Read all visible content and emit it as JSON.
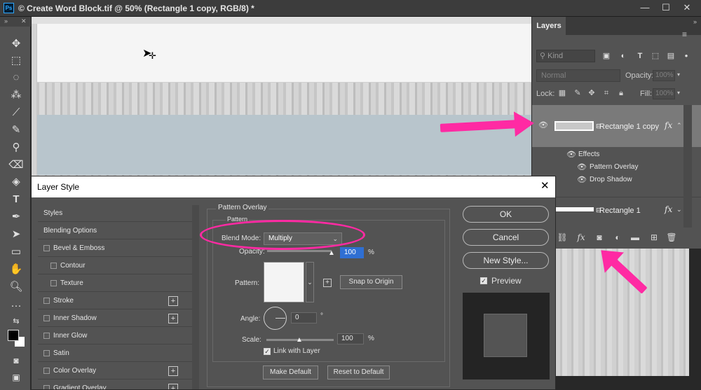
{
  "window": {
    "title": "© Create Word Block.tif @ 50% (Rectangle 1 copy, RGB/8) *",
    "ps_logo": "Ps",
    "minimize": "—",
    "maximize": "☐",
    "close": "✕"
  },
  "toolbar": {
    "header_left": "»",
    "header_right": "✕",
    "tools": [
      "move-tool",
      "marquee-tool",
      "lasso-tool",
      "magic-wand-tool",
      "eyedropper-tool",
      "brush-tool",
      "clone-stamp-tool",
      "eraser-tool",
      "paint-bucket-tool",
      "type-tool",
      "pen-tool",
      "path-selection-tool",
      "rectangle-tool",
      "hand-tool",
      "zoom-tool",
      "more-tools"
    ],
    "foreground_color": "#000000",
    "background_color": "#ffffff"
  },
  "layers_panel": {
    "tab": "Layers",
    "collapse": "»",
    "menu": "≡",
    "kind_placeholder": "Kind",
    "blend_mode": "Normal",
    "opacity_label": "Opacity:",
    "opacity_value": "100%",
    "lock_label": "Lock:",
    "fill_label": "Fill:",
    "fill_value": "100%",
    "layers": [
      {
        "name": "Rectangle 1 copy",
        "fx": "fx",
        "selected": true
      },
      {
        "name": "Rectangle 1",
        "fx": "fx",
        "selected": false
      }
    ],
    "effects_label": "Effects",
    "effects": [
      "Pattern Overlay",
      "Drop Shadow"
    ],
    "footer_icons": [
      "link-icon",
      "fx-icon",
      "mask-icon",
      "adjustment-icon",
      "folder-icon",
      "new-layer-icon",
      "trash-icon"
    ]
  },
  "dialog": {
    "title": "Layer Style",
    "close": "✕",
    "styles": [
      {
        "label": "Styles",
        "checkbox": false,
        "plus": false,
        "indent": 0
      },
      {
        "label": "Blending Options",
        "checkbox": false,
        "plus": false,
        "indent": 0
      },
      {
        "label": "Bevel & Emboss",
        "checkbox": true,
        "plus": false,
        "indent": 0
      },
      {
        "label": "Contour",
        "checkbox": true,
        "plus": false,
        "indent": 1
      },
      {
        "label": "Texture",
        "checkbox": true,
        "plus": false,
        "indent": 1
      },
      {
        "label": "Stroke",
        "checkbox": true,
        "plus": true,
        "indent": 0
      },
      {
        "label": "Inner Shadow",
        "checkbox": true,
        "plus": true,
        "indent": 0
      },
      {
        "label": "Inner Glow",
        "checkbox": true,
        "plus": false,
        "indent": 0
      },
      {
        "label": "Satin",
        "checkbox": true,
        "plus": false,
        "indent": 0
      },
      {
        "label": "Color Overlay",
        "checkbox": true,
        "plus": true,
        "indent": 0
      },
      {
        "label": "Gradient Overlay",
        "checkbox": true,
        "plus": true,
        "indent": 0
      }
    ],
    "pattern_overlay": {
      "group_title": "Pattern Overlay",
      "subgroup_title": "Pattern",
      "blend_mode_label": "Blend Mode:",
      "blend_mode": "Multiply",
      "opacity_label": "Opacity:",
      "opacity_value": "100",
      "opacity_unit": "%",
      "pattern_label": "Pattern:",
      "snap_to_origin": "Snap to Origin",
      "angle_label": "Angle:",
      "angle_value": "0",
      "angle_unit": "°",
      "scale_label": "Scale:",
      "scale_value": "100",
      "scale_unit": "%",
      "link_with_layer": "Link with Layer",
      "make_default": "Make Default",
      "reset_to_default": "Reset to Default"
    },
    "buttons": {
      "ok": "OK",
      "cancel": "Cancel",
      "new_style": "New Style..."
    },
    "preview_label": "Preview"
  },
  "annotation_color": "#ff2aa3"
}
